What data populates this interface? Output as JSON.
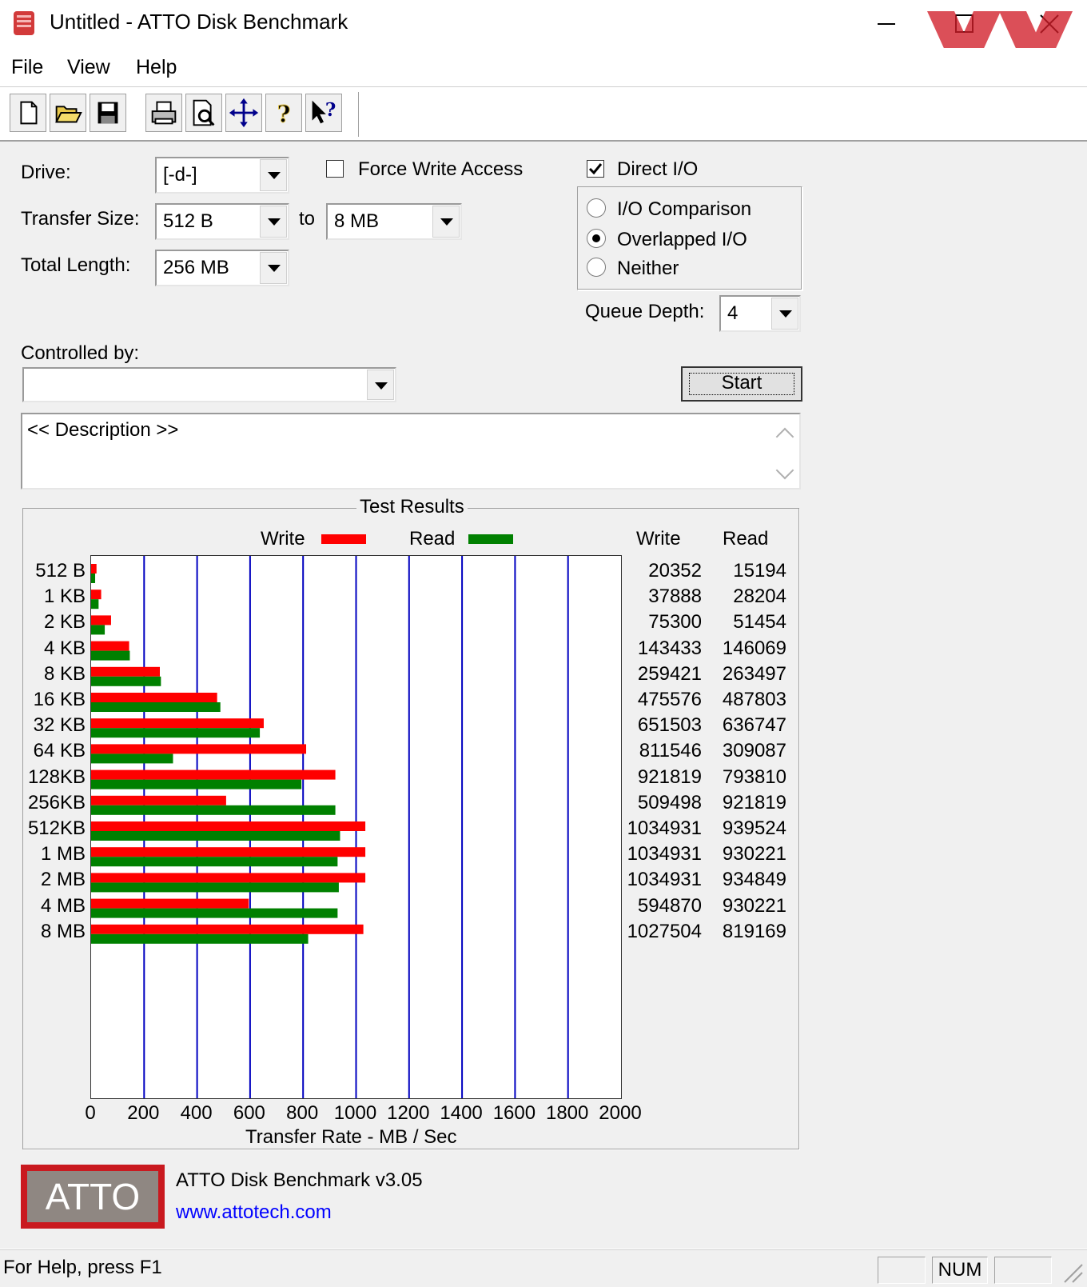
{
  "window": {
    "title": "Untitled - ATTO Disk Benchmark"
  },
  "menu": [
    "File",
    "View",
    "Help"
  ],
  "toolbar": {
    "buttons": [
      "new-icon",
      "open-icon",
      "save-icon",
      "print-icon",
      "print-preview-icon",
      "move-icon",
      "help-icon",
      "context-help-icon"
    ]
  },
  "form": {
    "drive_label": "Drive:",
    "drive_value": "[-d-]",
    "force_write_label": "Force Write Access",
    "force_write_checked": false,
    "direct_io_label": "Direct I/O",
    "direct_io_checked": true,
    "transfer_size_label": "Transfer Size:",
    "transfer_from": "512 B",
    "to_label": "to",
    "transfer_to": "8 MB",
    "total_length_label": "Total Length:",
    "total_length": "256 MB",
    "io_options": [
      {
        "label": "I/O Comparison",
        "selected": false
      },
      {
        "label": "Overlapped I/O",
        "selected": true
      },
      {
        "label": "Neither",
        "selected": false
      }
    ],
    "queue_depth_label": "Queue Depth:",
    "queue_depth": "4",
    "controlled_by_label": "Controlled by:",
    "controlled_by_value": "",
    "start_label": "Start",
    "description": "<< Description >>"
  },
  "results": {
    "title": "Test Results",
    "legend_write": "Write",
    "legend_read": "Read",
    "col_write": "Write",
    "col_read": "Read"
  },
  "chart_data": {
    "type": "bar",
    "orientation": "horizontal",
    "categories": [
      "512 B",
      "1 KB",
      "2 KB",
      "4 KB",
      "8 KB",
      "16 KB",
      "32 KB",
      "64 KB",
      "128KB",
      "256KB",
      "512KB",
      "1 MB",
      "2 MB",
      "4 MB",
      "8 MB"
    ],
    "series": [
      {
        "name": "Write",
        "color": "#ff0000",
        "values": [
          20352,
          37888,
          75300,
          143433,
          259421,
          475576,
          651503,
          811546,
          921819,
          509498,
          1034931,
          1034931,
          1034931,
          594870,
          1027504
        ]
      },
      {
        "name": "Read",
        "color": "#008000",
        "values": [
          15194,
          28204,
          51454,
          146069,
          263497,
          487803,
          636747,
          309087,
          793810,
          921819,
          939524,
          930221,
          934849,
          930221,
          819169
        ]
      }
    ],
    "value_unit": "KB/s",
    "xlabel": "Transfer Rate - MB / Sec",
    "xticks": [
      "0",
      "200",
      "400",
      "600",
      "800",
      "1000",
      "1200",
      "1400",
      "1600",
      "1800",
      "2000"
    ],
    "xlim": [
      0,
      2000
    ],
    "grid": true,
    "grid_color": "#0000c0",
    "legend_position": "top"
  },
  "footer": {
    "logo_text": "ATTO",
    "product": "ATTO Disk Benchmark v3.05",
    "link": "www.attotech.com",
    "link_color": "#0000ff"
  },
  "status": {
    "help_text": "For Help, press F1",
    "num": "NUM"
  }
}
